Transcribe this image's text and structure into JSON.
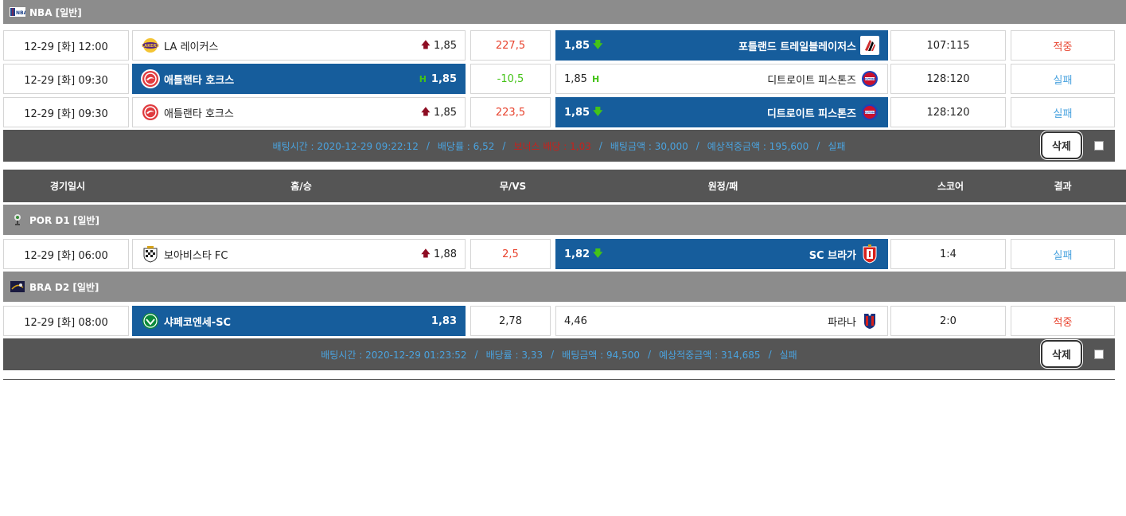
{
  "groups": [
    {
      "league": "NBA [일반]",
      "league_icon": "nba-logo",
      "rows": [
        {
          "date": "12-29 [화] 12:00",
          "home": "LA 레이커스",
          "home_logo_color": "#f4c433",
          "home_odds": "1,85",
          "mid": "227,5",
          "away_odds": "1,85",
          "away": "포틀랜드 트레일블레이저스",
          "away_logo_color": "#cf2e2e",
          "score": "107:115",
          "result": "적중"
        },
        {
          "date": "12-29 [화] 09:30",
          "home": "애틀랜타 호크스",
          "home_logo_color": "#e03a3e",
          "home_odds": "1,85",
          "mid": "-10,5",
          "away_odds": "1,85",
          "away": "디트로이트 피스톤즈",
          "away_logo_color": "#c8102e",
          "score": "128:120",
          "result": "실패"
        },
        {
          "date": "12-29 [화] 09:30",
          "home": "애틀랜타 호크스",
          "home_logo_color": "#e03a3e",
          "home_odds": "1,85",
          "mid": "223,5",
          "away_odds": "1,85",
          "away": "디트로이트 피스톤즈",
          "away_logo_color": "#c8102e",
          "score": "128:120",
          "result": "실패"
        }
      ],
      "summary": {
        "bet_time": "배팅시간 : 2020-12-29 09:22:12",
        "odds": "배당률 : 6,52",
        "bonus": "보너스 배당 : 1,03",
        "amount": "배팅금액 : 30,000",
        "expected": "예상적중금액 : 195,600",
        "status": "실패",
        "delete_label": "삭제"
      }
    }
  ],
  "header": {
    "date": "경기일시",
    "home": "홈/승",
    "mid": "무/VS",
    "away": "원정/패",
    "score": "스코어",
    "result": "결과"
  },
  "group2": {
    "league_a": "POR D1 [일반]",
    "league_b": "BRA D2 [일반]",
    "row_a": {
      "date": "12-29 [화] 06:00",
      "home": "보아비스타 FC",
      "home_odds": "1,88",
      "mid": "2,5",
      "away_odds": "1,82",
      "away": "SC 브라가",
      "score": "1:4",
      "result": "실패"
    },
    "row_b": {
      "date": "12-29 [화] 08:00",
      "home": "샤페코엔세-SC",
      "home_odds": "1,83",
      "mid": "2,78",
      "away_odds": "4,46",
      "away": "파라나",
      "score": "2:0",
      "result": "적중"
    },
    "summary": {
      "bet_time": "배팅시간 : 2020-12-29 01:23:52",
      "odds": "배당률 : 3,33",
      "amount": "배팅금액 : 94,500",
      "expected": "예상적중금액 : 314,685",
      "status": "실패",
      "delete_label": "삭제"
    }
  },
  "colors": {
    "selected": "#165d9c",
    "win": "#e8432e",
    "lose": "#4aa3df",
    "league_bar": "#8c8c8c",
    "dark_bar": "#555555"
  }
}
